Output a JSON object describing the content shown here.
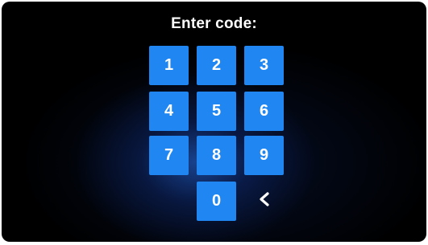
{
  "title": "Enter code:",
  "keypad": {
    "keys": [
      "1",
      "2",
      "3",
      "4",
      "5",
      "6",
      "7",
      "8",
      "9",
      "0"
    ],
    "backspace_icon": "chevron-left-icon",
    "key_color": "#1f86f2",
    "text_color": "#ffffff",
    "background_color": "#000000",
    "glow_color": "#1e6ee6"
  }
}
